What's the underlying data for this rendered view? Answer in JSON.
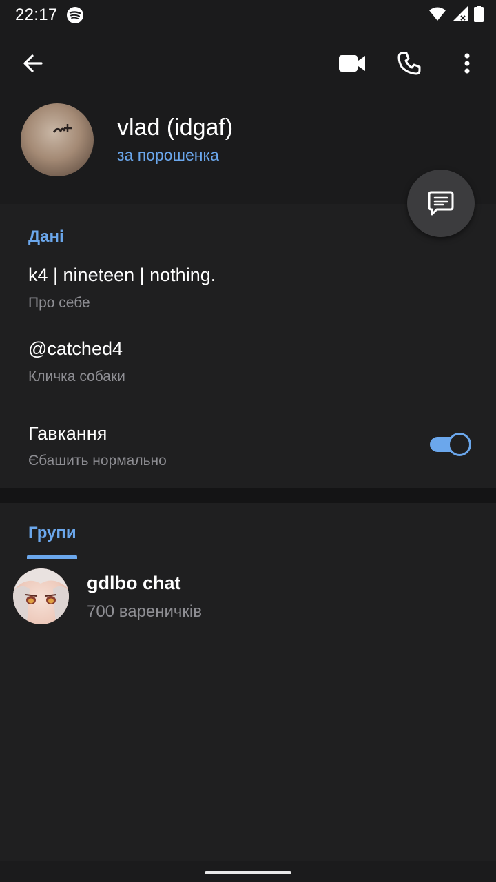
{
  "status_bar": {
    "time": "22:17",
    "icons": [
      "spotify-icon",
      "wifi-icon",
      "signal-icon",
      "battery-icon"
    ]
  },
  "toolbar": {
    "icons": [
      "back-arrow-icon",
      "video-call-icon",
      "phone-icon",
      "more-vert-icon"
    ]
  },
  "profile": {
    "name": "vlad (idgaf)",
    "status": "за порошенка"
  },
  "fab": {
    "icon": "message-icon"
  },
  "info": {
    "section_title": "Дані",
    "bio": {
      "value": "k4 | nineteen | nothing.",
      "label": "Про себе"
    },
    "username": {
      "value": "@catched4",
      "label": "Кличка собаки"
    },
    "notifications": {
      "value": "Гавкання",
      "label": "Єбашить нормально",
      "enabled": true
    }
  },
  "groups": {
    "section_title": "Групи",
    "items": [
      {
        "name": "gdlbo chat",
        "members": "700 вареничків"
      }
    ]
  },
  "colors": {
    "background": "#1b1b1c",
    "surface": "#1f1f20",
    "accent": "#6ba7ec",
    "secondary_text": "#8e8e93"
  }
}
